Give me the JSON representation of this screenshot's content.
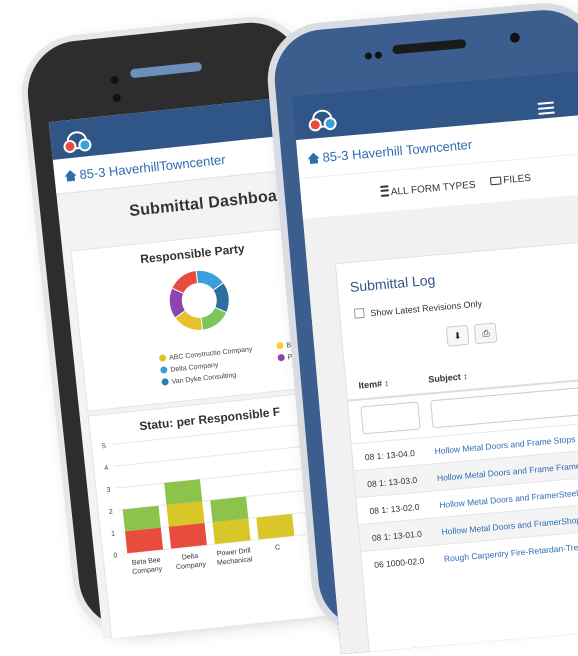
{
  "back": {
    "project_title": "85-3 HaverhillTowncenter",
    "dashboard_title": "Submittal Dashboa",
    "responsible_party_title": "Responsible Party",
    "legend": [
      {
        "label": "ABC Constructio Company",
        "color": "#e8c12a"
      },
      {
        "label": "Beta Bee C",
        "color": "#ffcc33"
      },
      {
        "label": "Delta Company",
        "color": "#3aa0dc"
      },
      {
        "label": "Power Drill",
        "color": "#8e44ad"
      },
      {
        "label": "Van Dyke Consulting",
        "color": "#2c7fb8"
      }
    ],
    "status_title": "Statu: per Responsible F",
    "donut_colors": [
      "#3aa0dc",
      "#2c6f9e",
      "#7fc45a",
      "#e8c12a",
      "#8e44ad",
      "#e84c3d"
    ]
  },
  "chart_data": {
    "type": "bar",
    "title": "Statu: per Responsible F",
    "categories": [
      "Beta Bee Company",
      "Delta Company",
      "Power Drill Mechanical",
      "C"
    ],
    "yticks": [
      "5",
      "4",
      "3",
      "2",
      "1",
      "0"
    ],
    "ylim": [
      0,
      5
    ],
    "series": [
      {
        "values": [
          1,
          1,
          0,
          0
        ],
        "color": "#e84c3d"
      },
      {
        "values": [
          0,
          1,
          1,
          1
        ],
        "color": "#d9c72a"
      },
      {
        "values": [
          1,
          1,
          1,
          0
        ],
        "color": "#8cc34a"
      }
    ]
  },
  "front": {
    "project_title": "85-3 Haverhill Towncenter",
    "tab_all": "ALL FORM TYPES",
    "tab_files": "FILES",
    "log_title": "Submittal Log",
    "show_latest": "Show Latest Revisions Only",
    "col_item": "Item# ↕",
    "col_subject": "Subject ↕",
    "rows": [
      {
        "num": "08 1: 13-04.0",
        "subject": "Hollow Metal Doors and Frame Stops an"
      },
      {
        "num": "08 1: 13-03.0",
        "subject": "Hollow Metal Doors and Frame Frame A"
      },
      {
        "num": "08 1: 13-02.0",
        "subject": "Hollow Metal Doors and FramerSteel Fra"
      },
      {
        "num": "08 1: 13-01.0",
        "subject": "Hollow Metal Doors and FramerShop Dr"
      },
      {
        "num": "06 1000-02.0",
        "subject": "Rough Carpentry Fire-Retardan-Treated"
      }
    ],
    "btn_download": "⬇",
    "btn_print": "⎙"
  }
}
